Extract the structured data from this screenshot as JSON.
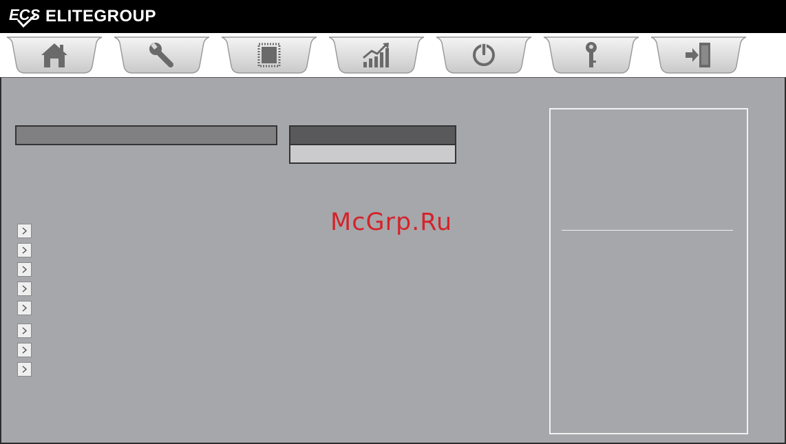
{
  "brand": {
    "name": "ELITEGROUP",
    "logo_icon": "ecs-logo-icon"
  },
  "tabs": [
    {
      "id": "main",
      "icon": "home-icon",
      "active": true
    },
    {
      "id": "advanced",
      "icon": "wrench-icon",
      "active": false
    },
    {
      "id": "chipset",
      "icon": "chip-icon",
      "active": false
    },
    {
      "id": "performance",
      "icon": "growth-chart-icon",
      "active": false
    },
    {
      "id": "boot",
      "icon": "power-icon",
      "active": false
    },
    {
      "id": "security",
      "icon": "key-icon",
      "active": false
    },
    {
      "id": "exit",
      "icon": "exit-door-icon",
      "active": false
    }
  ],
  "submenu_count": 8,
  "watermark": {
    "text": "McGrp.Ru",
    "color": "#d4232a"
  },
  "colors": {
    "header_bg": "#000000",
    "tabbar_bg": "#ffffff",
    "main_bg": "#a6a7ab",
    "panel_border": "#f2f2f2"
  }
}
